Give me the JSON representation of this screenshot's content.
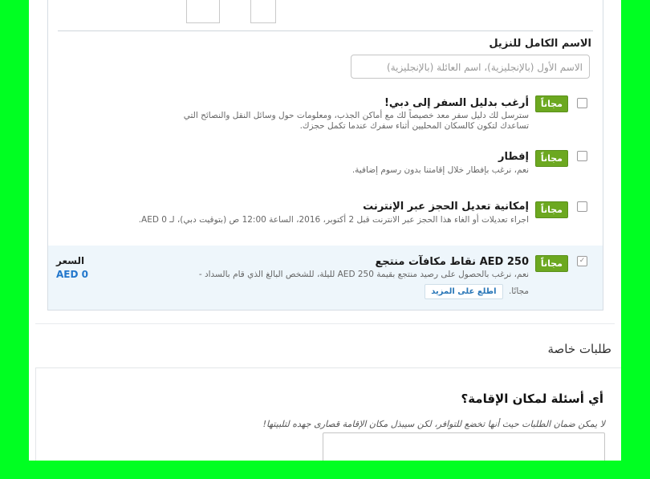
{
  "name_section": {
    "label": "الاسم الكامل للنزيل",
    "placeholder": "الاسم الأول (بالإنجليزية)، اسم العائلة (بالإنجليزية)"
  },
  "options": [
    {
      "checked": false,
      "badge": "مجاناً",
      "title": "أرغب بدليل السفر إلى دبي!",
      "description": "سترسل لك دليل سفر معد خصيصاً لك مع أماكن الجذب، ومعلومات حول وسائل النقل والنصائح التي تساعدك لتكون كالسكان المحليين أثناء سفرك عندما تكمل حجزك."
    },
    {
      "checked": false,
      "badge": "مجاناً",
      "title": "إفطار",
      "description": "نعم، نرغب بإفطار خلال إقامتنا بدون رسوم إضافية."
    },
    {
      "checked": false,
      "badge": "مجاناً",
      "title": "إمكانية تعديل الحجز عبر الإنترنت",
      "description": "اجراء تعديلات أو الغاء هذا الحجز عبر الانترنت قبل 2 أكتوبر، 2016، الساعة 12:00 ص (بتوقيت دبي)، لـ AED 0."
    },
    {
      "checked": true,
      "badge": "مجاناً",
      "title": "AED 250 نقاط مكافآت منتجع",
      "description": "نعم، نرغب بالحصول على رصيد منتجع بقيمة AED 250 لليلة، للشخص البالغ الذي قام بالسداد -",
      "suffix": "مجانًا.",
      "more_label": "اطلع على المزيد",
      "price_label": "السعر",
      "price_value": "AED 0"
    }
  ],
  "special_requests": {
    "title": "طلبات خاصة",
    "question": "أي أسئلة لمكان الإقامة؟",
    "note": "لا يمكن ضمان الطلبات حيث أنها تخضع للتوافر، لكن سيبذل مكان الإقامة قصارى جهده لتلبيتها!"
  },
  "colors": {
    "badge": "#6ca820",
    "selected_row": "#eef6fb",
    "price": "#2277cc",
    "background": "#00ff22"
  }
}
